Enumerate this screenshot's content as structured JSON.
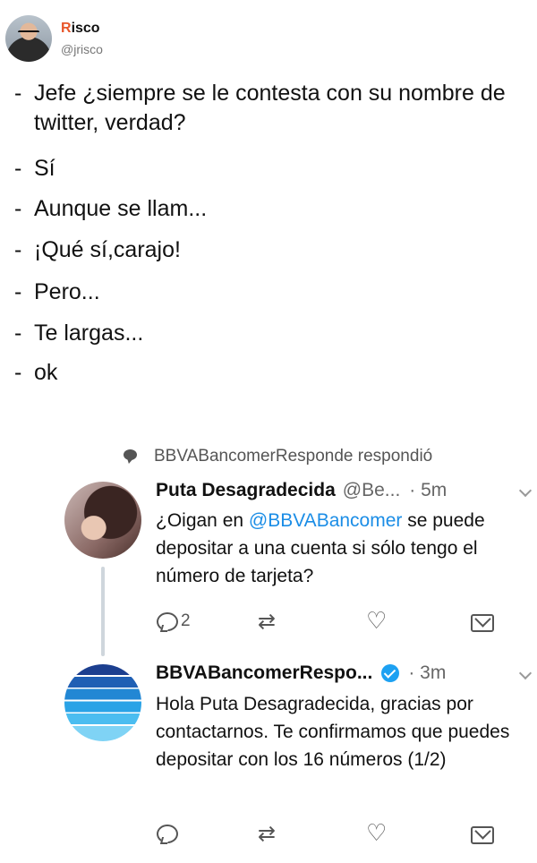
{
  "top_tweet": {
    "name_first_letter": "R",
    "name_rest": "isco",
    "handle": "@jrisco",
    "lines": [
      "Jefe ¿siempre se le contesta con su nombre de twitter, verdad?",
      "Sí",
      "Aunque se llam...",
      "¡Qué sí,carajo!",
      "Pero...",
      "Te largas...",
      "ok"
    ],
    "dash": "-"
  },
  "context": {
    "text": "BBVABancomerResponde respondió"
  },
  "tweets": [
    {
      "name": "Puta Desagradecida",
      "handle": "@Be...",
      "time": "· 5m",
      "body_before": "¿Oigan en ",
      "mention": "@BBVABancomer",
      "body_after": " se puede depositar a una cuenta si sólo tengo el número de tarjeta?",
      "reply_count": "2"
    },
    {
      "name": "BBVABancomerRespo...",
      "time": "· 3m",
      "body": "Hola Puta Desagradecida, gracias por contactarnos. Te confirmamos que puedes depositar con los 16 números (1/2)",
      "reply_count": ""
    }
  ],
  "icons": {
    "reply": "reply-icon",
    "retweet": "retweet-icon",
    "like": "heart-icon",
    "dm": "envelope-icon",
    "retweet_glyph": "⇄",
    "like_glyph": "♡"
  },
  "colors": {
    "mention": "#1b8de6",
    "verified": "#1da1f2",
    "name_accent": "#e8562a"
  }
}
